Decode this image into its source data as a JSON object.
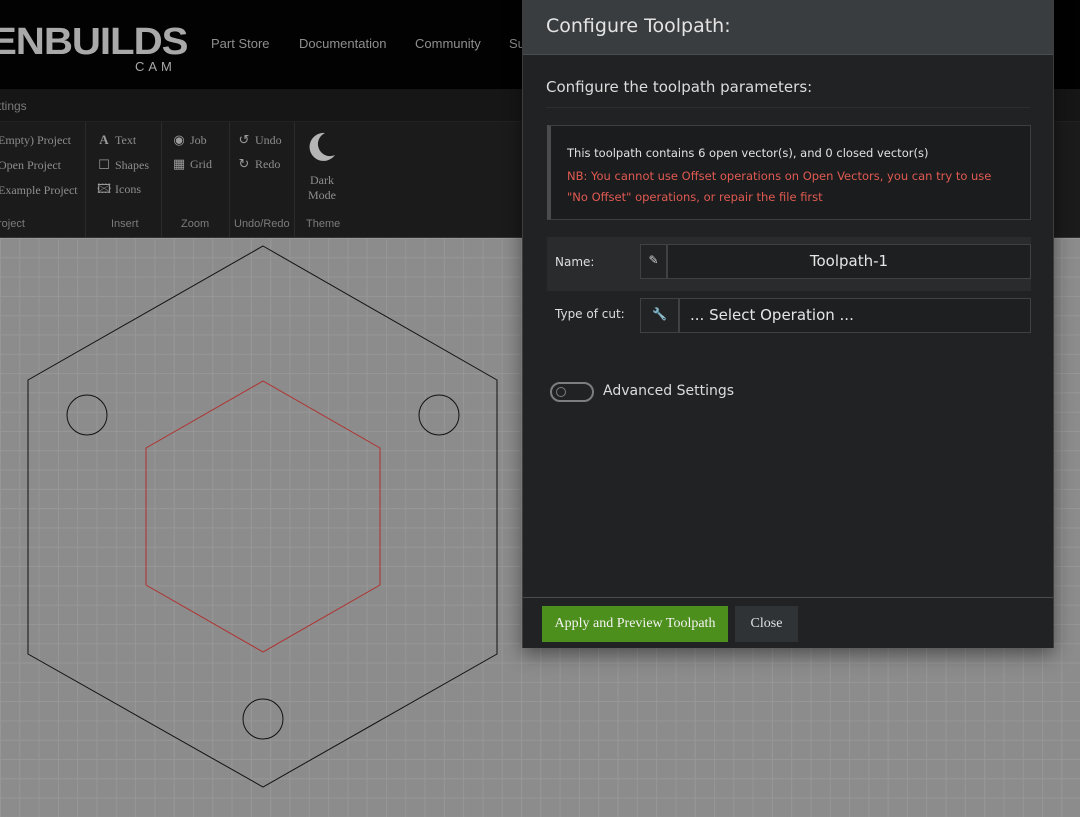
{
  "app": {
    "logo_text": "ENBUILDS",
    "logo_sub": "CAM",
    "nav": [
      "Part Store",
      "Documentation",
      "Community",
      "Su"
    ]
  },
  "ribbon": {
    "tab_label": "ttings",
    "project": {
      "items": [
        "Empty) Project",
        "Open Project",
        "Example Project"
      ],
      "label": "roject"
    },
    "insert": {
      "items": [
        "Text",
        "Shapes",
        "Icons"
      ],
      "label": "Insert"
    },
    "zoom": {
      "items": [
        "Job",
        "Grid"
      ],
      "label": "Zoom"
    },
    "undo": {
      "items": [
        "Undo",
        "Redo"
      ],
      "label": "Undo/Redo"
    },
    "theme": {
      "dark_mode_line1": "Dark",
      "dark_mode_line2": "Mode",
      "label": "Theme"
    }
  },
  "canvas": {
    "outer_color": "#111111",
    "inner_color": "#b0302f"
  },
  "modal": {
    "title": "Configure Toolpath:",
    "subtitle": "Configure the toolpath parameters:",
    "info": "This toolpath contains 6 open vector(s), and 0 closed vector(s)",
    "warning": "NB: You cannot use Offset operations on Open Vectors, you can try to use \"No Offset\" operations, or repair the file first",
    "name_label": "Name:",
    "name_value": "Toolpath-1",
    "cut_label": "Type of cut:",
    "cut_value": "... Select Operation ...",
    "advanced_label": "Advanced Settings",
    "advanced_enabled": false,
    "apply_label": "Apply and Preview Toolpath",
    "close_label": "Close",
    "apply_color": "#4d8f1c",
    "warning_color": "#e05a52"
  }
}
